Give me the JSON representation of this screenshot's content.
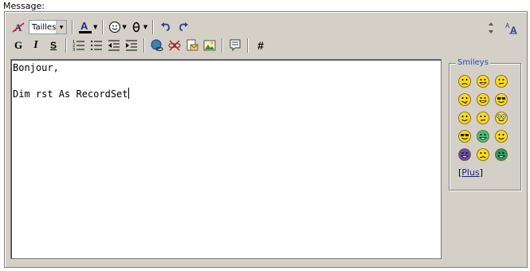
{
  "label": "Message:",
  "toolbar": {
    "size_select": "Tailles",
    "bold_label": "G",
    "italic_label": "I",
    "underline_label": "S",
    "code_label": "#"
  },
  "editor": {
    "lines": [
      "Bonjour,",
      "",
      "Dim rst As RecordSet"
    ]
  },
  "smileys": {
    "title": "Smileys",
    "plus_open": "[",
    "plus_label": "Plus",
    "plus_close": "]",
    "faces": [
      "sad",
      "grin",
      "confused",
      "tongue",
      "laugh",
      "cool",
      "smile",
      "worried",
      "eyes",
      "glasses",
      "teeth-green",
      "happy",
      "purple",
      "unsure",
      "teeth-dark"
    ]
  },
  "colors": {
    "panel": "#d4d0c8",
    "accent": "#2a4aa0",
    "link": "#1a1aa6"
  }
}
